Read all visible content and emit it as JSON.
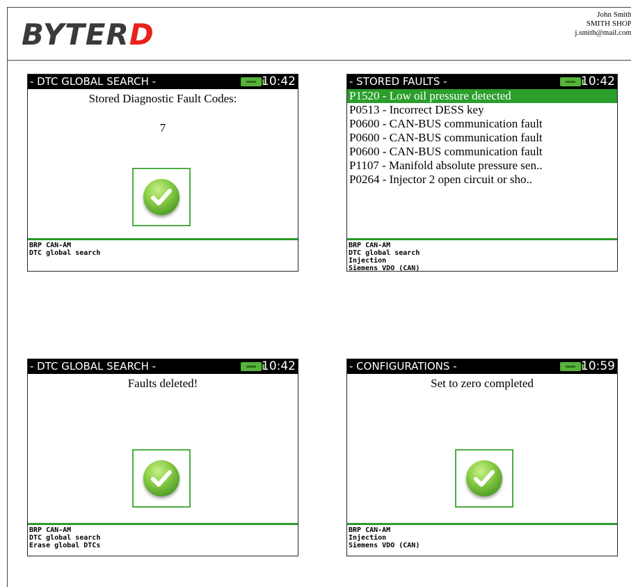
{
  "header": {
    "logo_part1": "BYTER",
    "logo_part2": "D",
    "contact_name": "John Smith",
    "contact_shop": "SMITH SHOP",
    "contact_email": "j.smith@mail.com"
  },
  "screens": [
    {
      "title": "- DTC GLOBAL SEARCH -",
      "time": "10:42",
      "message": "Stored Diagnostic Fault Codes:",
      "count": "7",
      "footer": [
        "BRP CAN-AM",
        "DTC global search"
      ]
    },
    {
      "title": "- STORED FAULTS -",
      "time": "10:42",
      "faults": [
        "P1520 - Low oil pressure detected",
        "P0513 - Incorrect DESS key",
        "P0600 - CAN-BUS communication fault",
        "P0600 - CAN-BUS communication fault",
        "P0600 - CAN-BUS communication fault",
        "P1107 - Manifold absolute pressure sen..",
        "P0264 - Injector 2 open circuit or sho.."
      ],
      "footer": [
        "BRP CAN-AM",
        "DTC global search",
        "Injection",
        "Siemens VDO (CAN)"
      ]
    },
    {
      "title": "- DTC GLOBAL SEARCH -",
      "time": "10:42",
      "message": "Faults deleted!",
      "footer": [
        "BRP CAN-AM",
        "DTC global search",
        "Erase global DTCs"
      ]
    },
    {
      "title": "- CONFIGURATIONS -",
      "time": "10:59",
      "message": "Set to zero completed",
      "footer": [
        "BRP CAN-AM",
        "Injection",
        "Siemens VDO (CAN)"
      ]
    }
  ],
  "colors": {
    "accent_green": "#2b9e2b",
    "logo_red": "#e8231c",
    "titlebar_bg": "#000000"
  }
}
